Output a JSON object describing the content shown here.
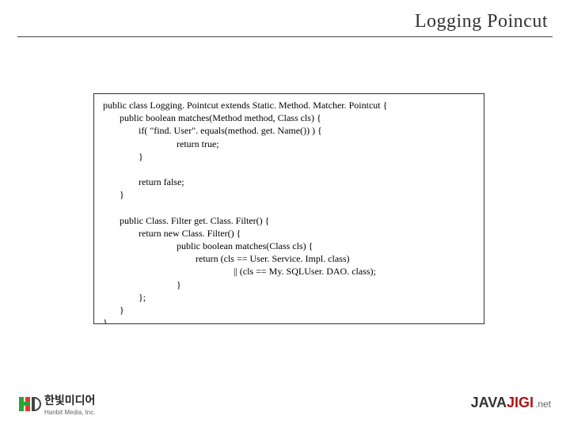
{
  "header": {
    "title": "Logging Poincut"
  },
  "code": {
    "lines": [
      " public class Logging. Pointcut extends Static. Method. Matcher. Pointcut {",
      "        public boolean matches(Method method, Class cls) {",
      "                if( \"find. User\". equals(method. get. Name()) ) {",
      "                                return true;",
      "                }",
      "",
      "                return false;",
      "        }",
      "",
      "        public Class. Filter get. Class. Filter() {",
      "                return new Class. Filter() {",
      "                                public boolean matches(Class cls) {",
      "                                        return (cls == User. Service. Impl. class)",
      "                                                        || (cls == My. SQLUser. DAO. class);",
      "                                }",
      "                };",
      "        }",
      " }"
    ]
  },
  "footer": {
    "left": {
      "name": "한빛미디어",
      "sub": "Hanbit Media, Inc."
    },
    "right": {
      "part1": "JAVA",
      "part2": "JIGI",
      "suffix": ".net"
    }
  }
}
